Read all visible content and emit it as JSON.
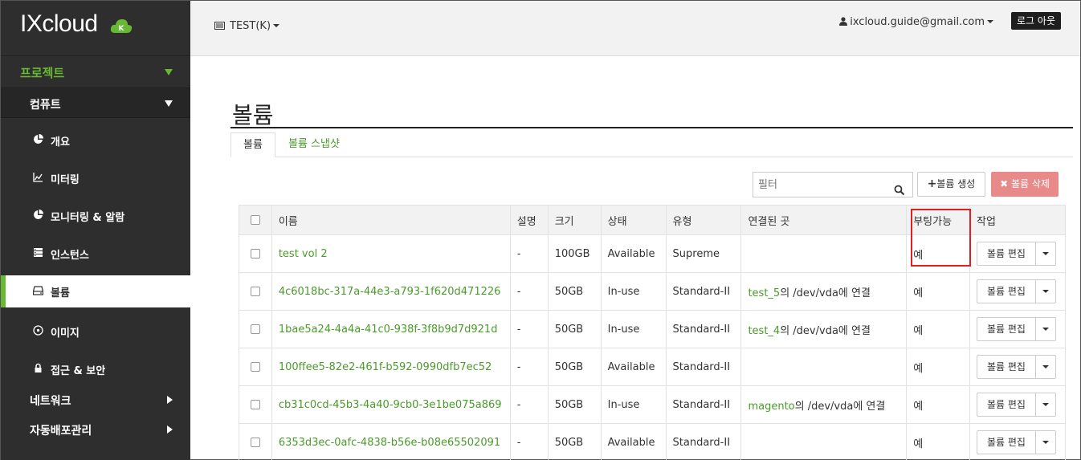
{
  "brand": {
    "name": "IXcloud",
    "badge_letter": "K"
  },
  "sidebar": {
    "project_label": "프로젝트",
    "compute_label": "컴퓨트",
    "items": [
      {
        "label": "개요",
        "icon": "pie-chart-icon"
      },
      {
        "label": "미터링",
        "icon": "line-chart-icon"
      },
      {
        "label": "모니터링 & 알람",
        "icon": "pie-chart-icon"
      },
      {
        "label": "인스턴스",
        "icon": "server-icon"
      },
      {
        "label": "볼륨",
        "icon": "hdd-icon",
        "active": true
      },
      {
        "label": "이미지",
        "icon": "disc-icon"
      },
      {
        "label": "접근 & 보안",
        "icon": "lock-icon"
      }
    ],
    "groups": [
      {
        "label": "네트워크"
      },
      {
        "label": "자동배포관리"
      }
    ]
  },
  "topbar": {
    "project": "TEST(K)",
    "user_email": "ixcloud.guide@gmail.com",
    "logout_label": "로그 아웃"
  },
  "main": {
    "title": "볼륨",
    "tabs": [
      {
        "label": "볼륨",
        "active": true
      },
      {
        "label": "볼륨 스냅샷",
        "active": false
      }
    ],
    "filter_placeholder": "필터",
    "create_label": "볼륨 생성",
    "delete_label": "볼륨 삭제"
  },
  "table": {
    "columns": [
      "이름",
      "설명",
      "크기",
      "상태",
      "유형",
      "연결된 곳",
      "부팅가능",
      "작업"
    ],
    "edit_label": "볼륨 편집",
    "rows": [
      {
        "name": "test vol 2",
        "desc": "-",
        "size": "100GB",
        "status": "Available",
        "type": "Supreme",
        "attached_link": "",
        "attached_text": "",
        "bootable": "예"
      },
      {
        "name": "4c6018bc-317a-44e3-a793-1f620d471226",
        "desc": "-",
        "size": "50GB",
        "status": "In-use",
        "type": "Standard-II",
        "attached_link": "test_5",
        "attached_text": "의 /dev/vda에 연결",
        "bootable": "예"
      },
      {
        "name": "1bae5a24-4a4a-41c0-938f-3f8b9d7d921d",
        "desc": "-",
        "size": "50GB",
        "status": "In-use",
        "type": "Standard-II",
        "attached_link": "test_4",
        "attached_text": "의 /dev/vda에 연결",
        "bootable": "예"
      },
      {
        "name": "100ffee5-82e2-461f-b592-0990dfb7ec52",
        "desc": "-",
        "size": "50GB",
        "status": "Available",
        "type": "Standard-II",
        "attached_link": "",
        "attached_text": "",
        "bootable": "예"
      },
      {
        "name": "cb31c0cd-45b3-4a40-9cb0-3e1be075a869",
        "desc": "-",
        "size": "50GB",
        "status": "In-use",
        "type": "Standard-II",
        "attached_link": "magento",
        "attached_text": "의 /dev/vda에 연결",
        "bootable": "예"
      },
      {
        "name": "6353d3ec-0afc-4838-b56e-b08e65502091",
        "desc": "-",
        "size": "50GB",
        "status": "Available",
        "type": "Standard-II",
        "attached_link": "",
        "attached_text": "",
        "bootable": "예"
      }
    ]
  },
  "colors": {
    "accent": "#67b832",
    "link": "#4a9b2a",
    "delete": "#e88a8a",
    "highlight": "#e02020"
  }
}
